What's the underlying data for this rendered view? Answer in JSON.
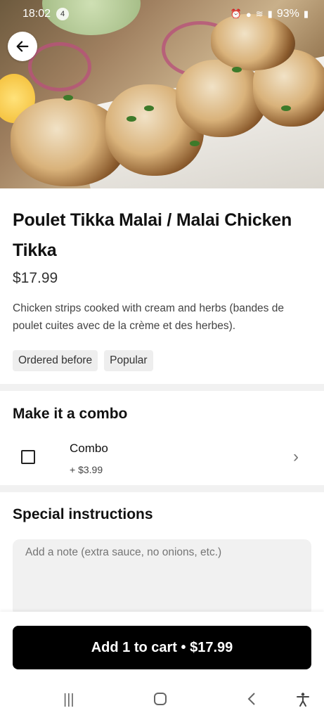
{
  "status_bar": {
    "time": "18:02",
    "notif_count": "4",
    "battery": "93%"
  },
  "item": {
    "title": "Poulet Tikka Malai / Malai Chicken Tikka",
    "price": "$17.99",
    "description": "Chicken strips cooked with cream and herbs (bandes de poulet cuites avec de la crème et des herbes).",
    "tags": [
      "Ordered before",
      "Popular"
    ]
  },
  "combo": {
    "section_title": "Make it a combo",
    "option_label": "Combo",
    "option_price": "+ $3.99"
  },
  "instructions": {
    "section_title": "Special instructions",
    "placeholder": "Add a note (extra sauce, no onions, etc.)"
  },
  "cart_button": {
    "label": "Add 1 to cart • $17.99"
  },
  "icons": {
    "back": "arrow-left-icon",
    "chevron": "chevron-right-icon",
    "nav_recents": "recents-icon",
    "nav_home": "home-icon",
    "nav_back": "nav-back-icon",
    "nav_accessibility": "accessibility-icon"
  }
}
